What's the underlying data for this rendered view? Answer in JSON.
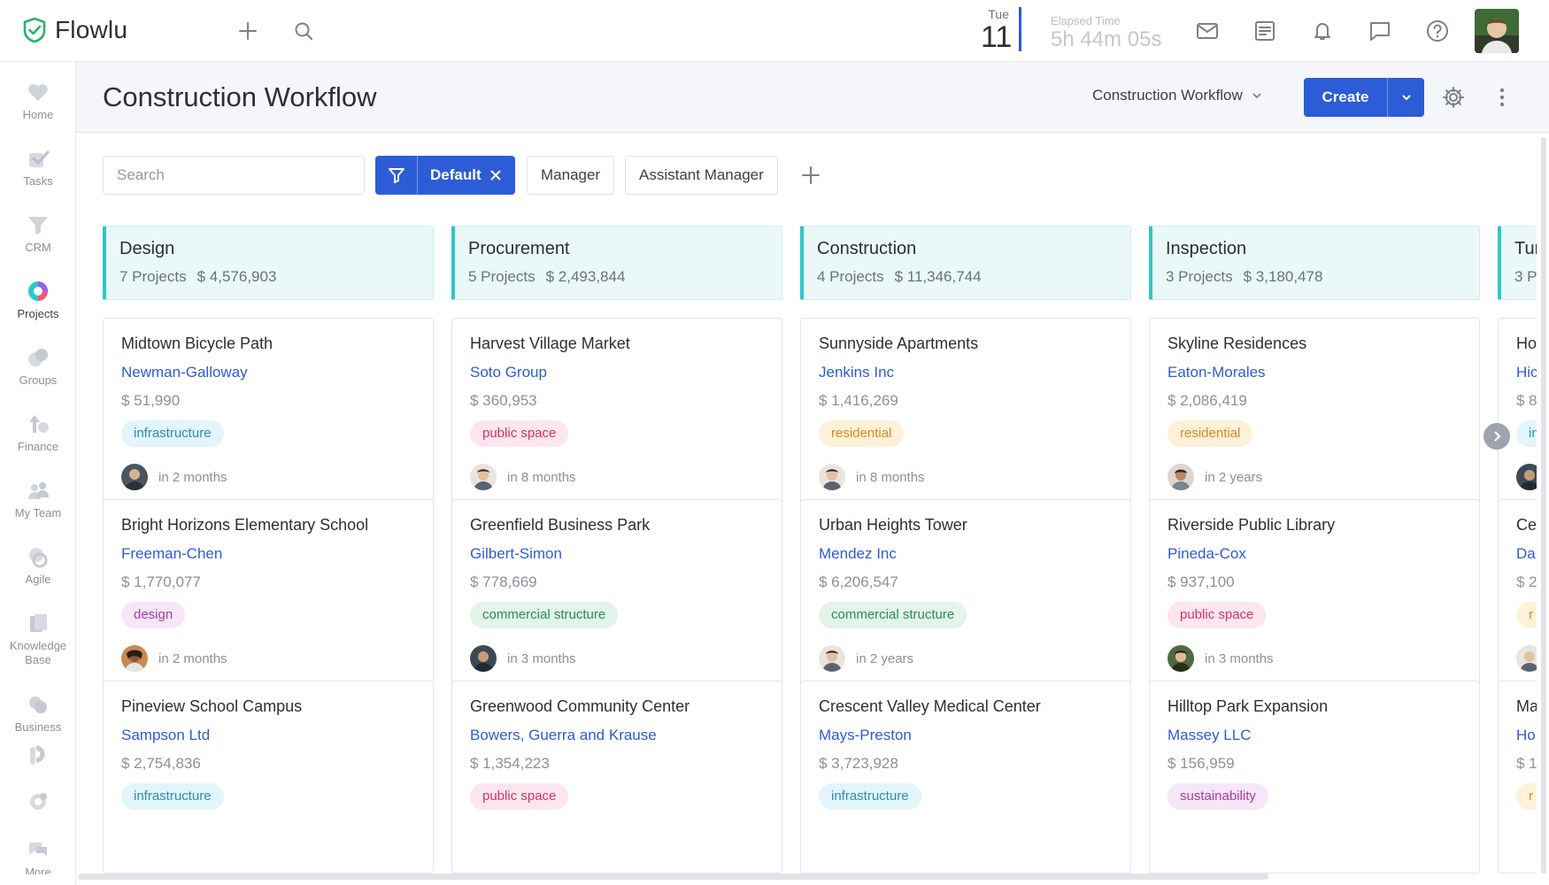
{
  "app": {
    "name": "Flowlu"
  },
  "topbar": {
    "date_day": "Tue",
    "date_num": "11",
    "elapsed_label": "Elapsed Time",
    "elapsed_value": "5h 44m 05s"
  },
  "sidebar": {
    "items": [
      {
        "label": "Home",
        "icon": "heart-icon"
      },
      {
        "label": "Tasks",
        "icon": "check-icon"
      },
      {
        "label": "CRM",
        "icon": "funnel-icon"
      },
      {
        "label": "Projects",
        "icon": "projects-icon"
      },
      {
        "label": "Groups",
        "icon": "groups-icon"
      },
      {
        "label": "Finance",
        "icon": "finance-icon"
      },
      {
        "label": "My Team",
        "icon": "team-icon"
      },
      {
        "label": "Agile",
        "icon": "agile-icon"
      },
      {
        "label": "Knowledge Base",
        "icon": "book-icon"
      },
      {
        "label": "Business",
        "icon": "business-icon"
      },
      {
        "label": "",
        "icon": "integrations-icon"
      },
      {
        "label": "",
        "icon": "settings-icon"
      },
      {
        "label": "More",
        "icon": "more-icon"
      }
    ]
  },
  "header": {
    "title": "Construction Workflow",
    "workflow_select": "Construction Workflow",
    "create_label": "Create"
  },
  "filters": {
    "search_placeholder": "Search",
    "active_filter": "Default",
    "chips": [
      "Manager",
      "Assistant Manager"
    ]
  },
  "colors": {
    "accent": "#2c5cd6",
    "stage": "#2fc6c8"
  },
  "columns": [
    {
      "title": "Design",
      "count": "7 Projects",
      "total": "$ 4,576,903",
      "cards": [
        {
          "title": "Midtown Bicycle Path",
          "client": "Newman-Galloway",
          "amount": "$ 51,990",
          "tag": "infrastructure",
          "due": "in 2 months"
        },
        {
          "title": "Bright Horizons Elementary School",
          "client": "Freeman-Chen",
          "amount": "$ 1,770,077",
          "tag": "design",
          "due": "in 2 months"
        },
        {
          "title": "Pineview School Campus",
          "client": "Sampson Ltd",
          "amount": "$ 2,754,836",
          "tag": "infrastructure",
          "due": ""
        }
      ]
    },
    {
      "title": "Procurement",
      "count": "5 Projects",
      "total": "$ 2,493,844",
      "cards": [
        {
          "title": "Harvest Village Market",
          "client": "Soto Group",
          "amount": "$ 360,953",
          "tag": "public space",
          "due": "in 8 months"
        },
        {
          "title": "Greenfield Business Park",
          "client": "Gilbert-Simon",
          "amount": "$ 778,669",
          "tag": "commercial structure",
          "due": "in 3 months"
        },
        {
          "title": "Greenwood Community Center",
          "client": "Bowers, Guerra and Krause",
          "amount": "$ 1,354,223",
          "tag": "public space",
          "due": ""
        }
      ]
    },
    {
      "title": "Construction",
      "count": "4 Projects",
      "total": "$ 11,346,744",
      "cards": [
        {
          "title": "Sunnyside Apartments",
          "client": "Jenkins Inc",
          "amount": "$ 1,416,269",
          "tag": "residential",
          "due": "in 8 months"
        },
        {
          "title": "Urban Heights Tower",
          "client": "Mendez Inc",
          "amount": "$ 6,206,547",
          "tag": "commercial structure",
          "due": "in 2 years"
        },
        {
          "title": "Crescent Valley Medical Center",
          "client": "Mays-Preston",
          "amount": "$ 3,723,928",
          "tag": "infrastructure",
          "due": ""
        }
      ]
    },
    {
      "title": "Inspection",
      "count": "3 Projects",
      "total": "$ 3,180,478",
      "cards": [
        {
          "title": "Skyline Residences",
          "client": "Eaton-Morales",
          "amount": "$ 2,086,419",
          "tag": "residential",
          "due": "in 2 years"
        },
        {
          "title": "Riverside Public Library",
          "client": "Pineda-Cox",
          "amount": "$ 937,100",
          "tag": "public space",
          "due": "in 3 months"
        },
        {
          "title": "Hilltop Park Expansion",
          "client": "Massey LLC",
          "amount": "$ 156,959",
          "tag": "sustainability",
          "due": ""
        }
      ]
    },
    {
      "title": "Tur",
      "count": "3 P",
      "total": "",
      "cards": [
        {
          "title": "Ho",
          "client": "Hic",
          "amount": "$ 8",
          "tag": "in",
          "due": ""
        },
        {
          "title": "Ce",
          "client": "Da",
          "amount": "$ 2",
          "tag": "r",
          "due": ""
        },
        {
          "title": "Ma",
          "client": "Ho",
          "amount": "$ 1",
          "tag": "r",
          "due": ""
        }
      ]
    }
  ]
}
